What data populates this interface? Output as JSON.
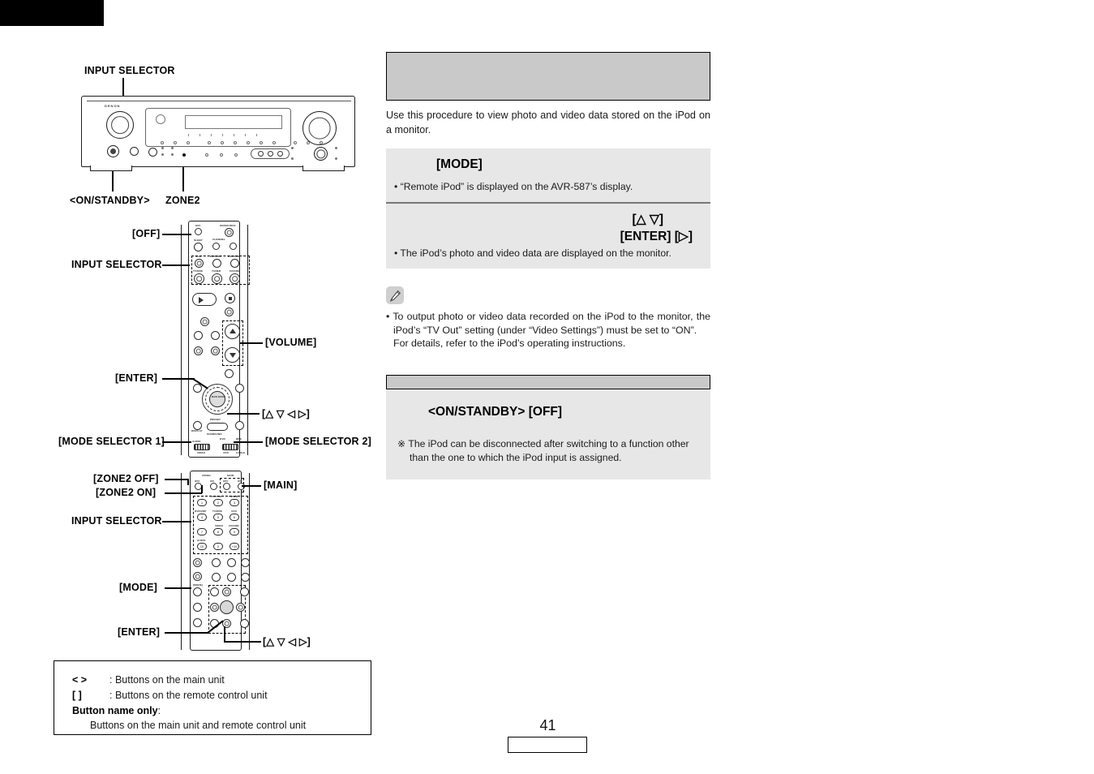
{
  "page": {
    "number": "41",
    "corner_tab": ""
  },
  "left": {
    "main_unit_callouts": {
      "input_selector": "INPUT SELECTOR",
      "on_standby": "<ON/STANDBY>",
      "zone2": "ZONE2"
    },
    "remote1_callouts": {
      "off": "[OFF]",
      "input_selector": "INPUT SELECTOR",
      "volume": "[VOLUME]",
      "enter": "[ENTER]",
      "cursor": "[△ ▽ ◁ ▷]",
      "mode_selector_1": "[MODE SELECTOR 1]",
      "mode_selector_2": "[MODE SELECTOR 2]"
    },
    "remote2_callouts": {
      "zone2_off": "[ZONE2 OFF]",
      "zone2_on": "[ZONE2 ON]",
      "main": "[MAIN]",
      "input_selector": "INPUT SELECTOR",
      "mode": "[MODE]",
      "enter": "[ENTER]",
      "cursor": "[△ ▽ ◁ ▷]"
    },
    "remote_button_labels": {
      "off": "OFF",
      "on_source": "ON/SOURCE",
      "sleep": "SLEEP",
      "channel": "CHANNEL",
      "ipod": "iPod",
      "dvd_vdp": "DVD/VDP",
      "dvr_vcr": "DVR/VCR",
      "tv_dbs": "TV/DBS",
      "tuner": "TUNER",
      "cd_cdr": "CD/CDR",
      "main_enter": "MAIN ENTER",
      "mode_select": "MODE",
      "audio": "AUDIO",
      "video": "VIDEO",
      "dvd": "DVD",
      "dbs": "DBS",
      "vcr": "VCR",
      "cable": "CABLE",
      "zone2": "ZONE2",
      "main_label": "MAIN",
      "on": "ON",
      "display": "DISPLAY",
      "preset": "PRESET",
      "surround": "SURROUND"
    },
    "remote2_keypad": [
      "1",
      "2",
      "3",
      "4",
      "5",
      "6",
      "7",
      "8",
      "9",
      "10",
      "0",
      "+10"
    ],
    "remote2_keypad_labels": [
      "",
      "CD",
      "TUNER",
      "DVD/VDP",
      "TV/DBS",
      "VCR",
      "",
      "V.AUX",
      "CDR/TAPE",
      "AUX",
      "",
      ""
    ],
    "legend": {
      "sym_main": "<    >",
      "text_main": ": Buttons on the main unit",
      "sym_remote": "[     ]",
      "text_remote": ": Buttons on the remote control unit",
      "sym_both": "Button name only",
      "text_both_colon": ":",
      "text_both": "Buttons on the main unit and remote control unit"
    }
  },
  "right": {
    "section_header": "",
    "intro": "Use this procedure to view photo and video data stored on the iPod on a monitor.",
    "steps": [
      {
        "keys": "[MODE]",
        "align": "left",
        "note": "• “Remote iPod” is displayed on the AVR-587’s display."
      },
      {
        "keys_line1": "[△  ▽]",
        "keys_line2": "[ENTER]      [▷]",
        "align": "right",
        "note": "• The iPod’s photo and video data are displayed on the monitor."
      }
    ],
    "note": {
      "icon": "pencil-icon",
      "line1": "• To output photo or video data recorded on the iPod to the monitor, the iPod’s “TV Out” setting (under “Video Settings”) must be set to “ON”.",
      "line2": "For details, refer to the iPod’s operating instructions."
    },
    "final": {
      "bar_title": "",
      "keys": "<ON/STANDBY>      [OFF]",
      "note": "※ The iPod can be disconnected after switching to a function other than the one to which the iPod input is assigned."
    }
  },
  "colors": {
    "gray_header": "#c9c9c9",
    "step_bg": "#e7e7e7",
    "step_divider": "#777777",
    "ink": "#1a1a1a",
    "black": "#000000"
  }
}
